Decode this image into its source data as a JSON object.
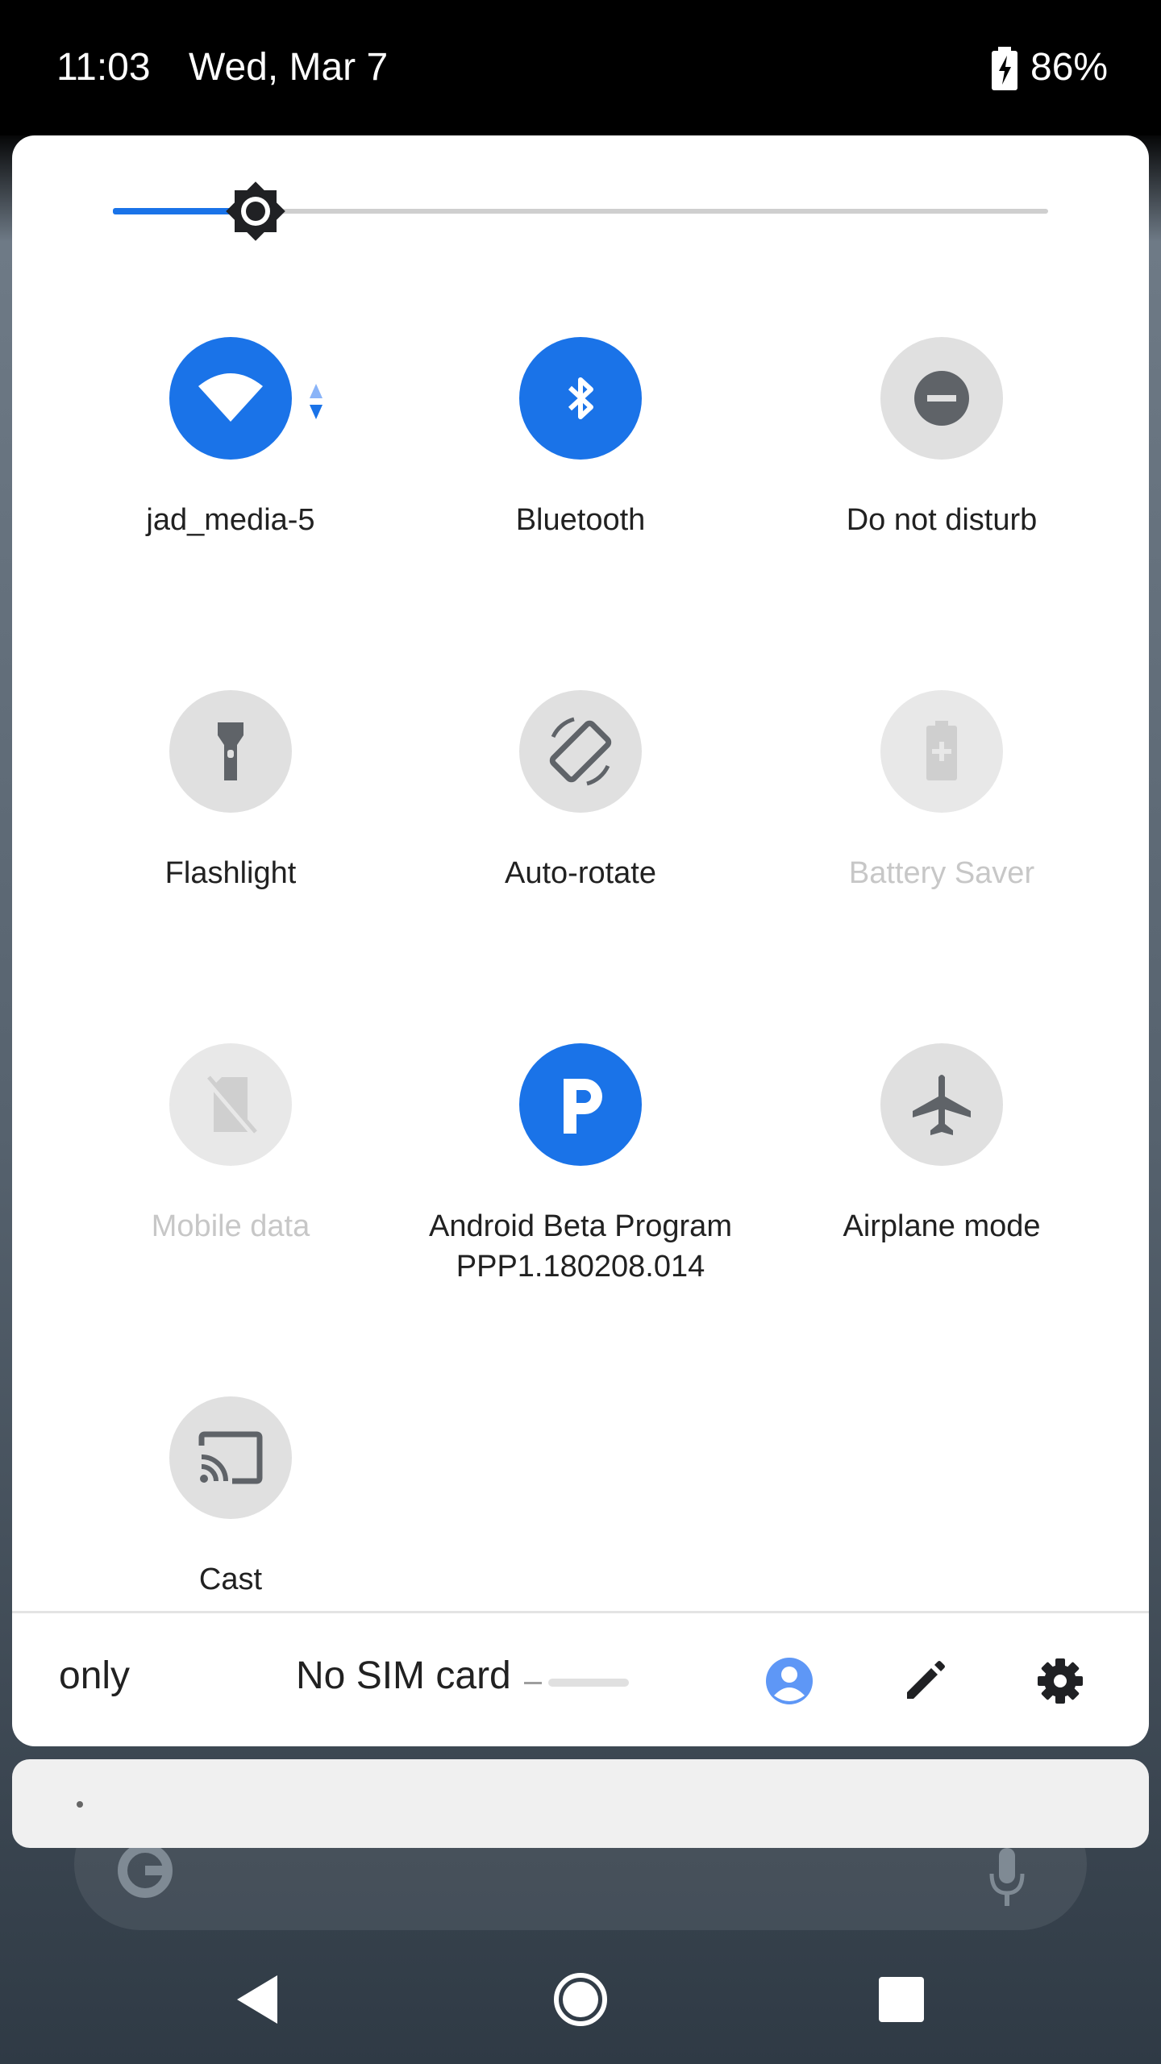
{
  "status_bar": {
    "time": "11:03",
    "date": "Wed, Mar 7",
    "battery_percent": "86%",
    "battery_icon": "battery-charging-icon"
  },
  "brightness": {
    "level_fraction": 0.15,
    "icon": "brightness-icon"
  },
  "tiles": [
    {
      "label": "jad_media-5",
      "icon": "wifi-icon",
      "state": "on"
    },
    {
      "label": "Bluetooth",
      "icon": "bluetooth-icon",
      "state": "on"
    },
    {
      "label": "Do not disturb",
      "icon": "do-not-disturb-icon",
      "state": "off"
    },
    {
      "label": "Flashlight",
      "icon": "flashlight-icon",
      "state": "off"
    },
    {
      "label": "Auto-rotate",
      "icon": "auto-rotate-icon",
      "state": "off"
    },
    {
      "label": "Battery Saver",
      "icon": "battery-saver-icon",
      "state": "disabled"
    },
    {
      "label": "Mobile data",
      "icon": "mobile-data-icon",
      "state": "disabled"
    },
    {
      "label": "Android Beta Program",
      "sublabel": "PPP1.180208.014",
      "icon": "beta-program-icon",
      "state": "on"
    },
    {
      "label": "Airplane mode",
      "icon": "airplane-icon",
      "state": "off"
    },
    {
      "label": "Cast",
      "icon": "cast-icon",
      "state": "off"
    }
  ],
  "footer": {
    "carrier_partial": "only",
    "carrier": "No SIM card",
    "icons": [
      "user-icon",
      "edit-icon",
      "settings-icon"
    ]
  },
  "notification": {
    "text": ""
  },
  "nav": {
    "icons": [
      "back-icon",
      "home-icon",
      "recents-icon"
    ]
  },
  "colors": {
    "accent": "#1a73e8",
    "tile_off": "#e0e0e0",
    "tile_icon": "#5f6368"
  }
}
